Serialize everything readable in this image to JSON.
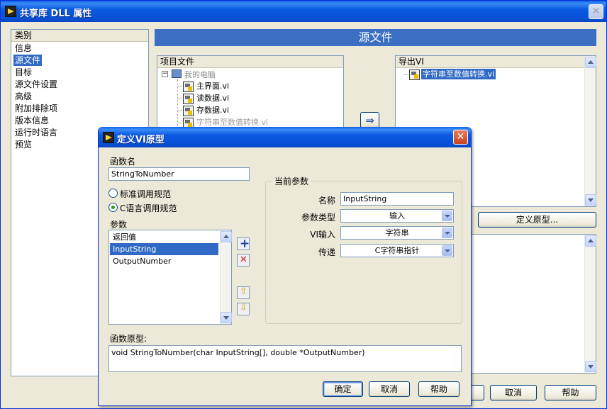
{
  "main_window": {
    "title": "共享库 DLL 属性",
    "close_symbol": "✕",
    "category": {
      "header": "类别",
      "items": [
        "信息",
        "源文件",
        "目标",
        "源文件设置",
        "高级",
        "附加排除项",
        "版本信息",
        "运行时语言",
        "预览"
      ],
      "selected_index": 1
    },
    "section_title": "源文件",
    "project_files": {
      "header": "项目文件",
      "root": "我的电脑",
      "items": [
        "主界面.vi",
        "读数据.vi",
        "存数据.vi",
        "字符串至数值转换.vi"
      ]
    },
    "export_vi": {
      "header": "导出VI",
      "items": [
        "字符串至数值转换.vi"
      ]
    },
    "define_prototype_label": "定义原型...",
    "cancel_label": "取消",
    "help_label": "帮助"
  },
  "dialog": {
    "title": "定义VI原型",
    "close_symbol": "✕",
    "function_name_label": "函数名",
    "function_name_value": "StringToNumber",
    "call_conventions": [
      "标准调用规范",
      "C语言调用规范"
    ],
    "selected_convention_index": 1,
    "params_label": "参数",
    "params": [
      "返回值",
      "InputString",
      "OutputNumber"
    ],
    "selected_param_index": 1,
    "current_param": {
      "group_label": "当前参数",
      "name_label": "名称",
      "name_value": "InputString",
      "type_label": "参数类型",
      "type_value": "输入",
      "vi_input_label": "VI输入",
      "vi_input_value": "字符串",
      "pass_label": "传递",
      "pass_value": "C字符串指针"
    },
    "prototype_label": "函数原型:",
    "prototype_value": "void StringToNumber(char InputString[], double *OutputNumber)",
    "ok_label": "确定",
    "cancel_label": "取消",
    "help_label": "帮助"
  },
  "colors": {
    "title_blue": "#0a5ae0",
    "section_bar": "#3a6fc4",
    "selection": "#316ac5",
    "close_red": "#c9431f"
  }
}
